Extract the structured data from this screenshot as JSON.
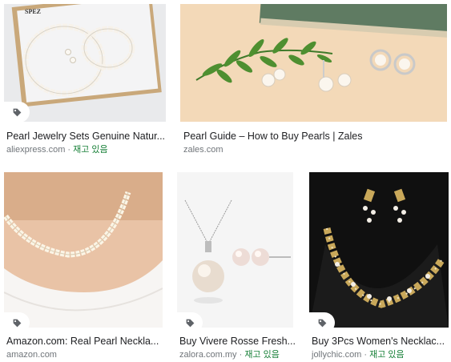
{
  "results": [
    {
      "title": "Pearl Jewelry Sets Genuine Natur...",
      "source": "aliexpress.com",
      "separator": " · ",
      "stock": "재고 있음",
      "image_text": "SPEZ",
      "has_tag": true
    },
    {
      "title": "Pearl Guide – How to Buy Pearls | Zales",
      "source": "zales.com",
      "separator": "",
      "stock": "",
      "has_tag": false
    },
    {
      "title": "Amazon.com: Real Pearl Neckla...",
      "source": "amazon.com",
      "separator": "",
      "stock": "",
      "has_tag": true
    },
    {
      "title": "Buy Vivere Rosse Fresh...",
      "source": "zalora.com.my",
      "separator": " · ",
      "stock": "재고 있음",
      "has_tag": true
    },
    {
      "title": "Buy 3Pcs Women's Necklac...",
      "source": "jollychic.com",
      "separator": " · ",
      "stock": "재고 있음",
      "has_tag": true
    }
  ],
  "colors": {
    "stock": "#188038",
    "source": "#70757a",
    "title": "#202124"
  }
}
